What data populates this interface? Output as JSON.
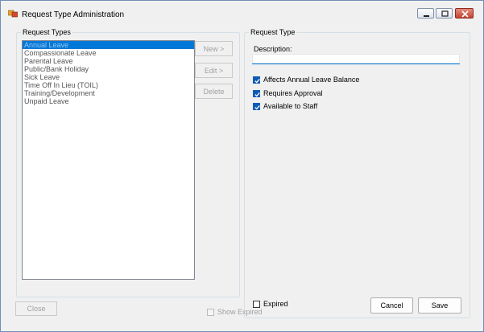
{
  "window": {
    "title": "Request Type Administration"
  },
  "request_types": {
    "legend": "Request Types",
    "items": [
      "Annual Leave",
      "Compassionate Leave",
      "Parental Leave",
      "Public/Bank Holiday",
      "Sick Leave",
      "Time Off In Lieu (TOIL)",
      "Training/Development",
      "Unpaid Leave"
    ],
    "selected_index": 0,
    "new_label": "New >",
    "edit_label": "Edit >",
    "delete_label": "Delete"
  },
  "request_type": {
    "legend": "Request Type",
    "description_label": "Description:",
    "description_value": "",
    "affects_balance_label": "Affects Annual Leave Balance",
    "affects_balance_checked": true,
    "requires_approval_label": "Requires Approval",
    "requires_approval_checked": true,
    "available_to_staff_label": "Available to Staff",
    "available_to_staff_checked": true,
    "expired_label": "Expired",
    "expired_checked": false,
    "cancel_label": "Cancel",
    "save_label": "Save"
  },
  "footer": {
    "close_label": "Close",
    "show_expired_label": "Show Expired",
    "show_expired_checked": false
  }
}
